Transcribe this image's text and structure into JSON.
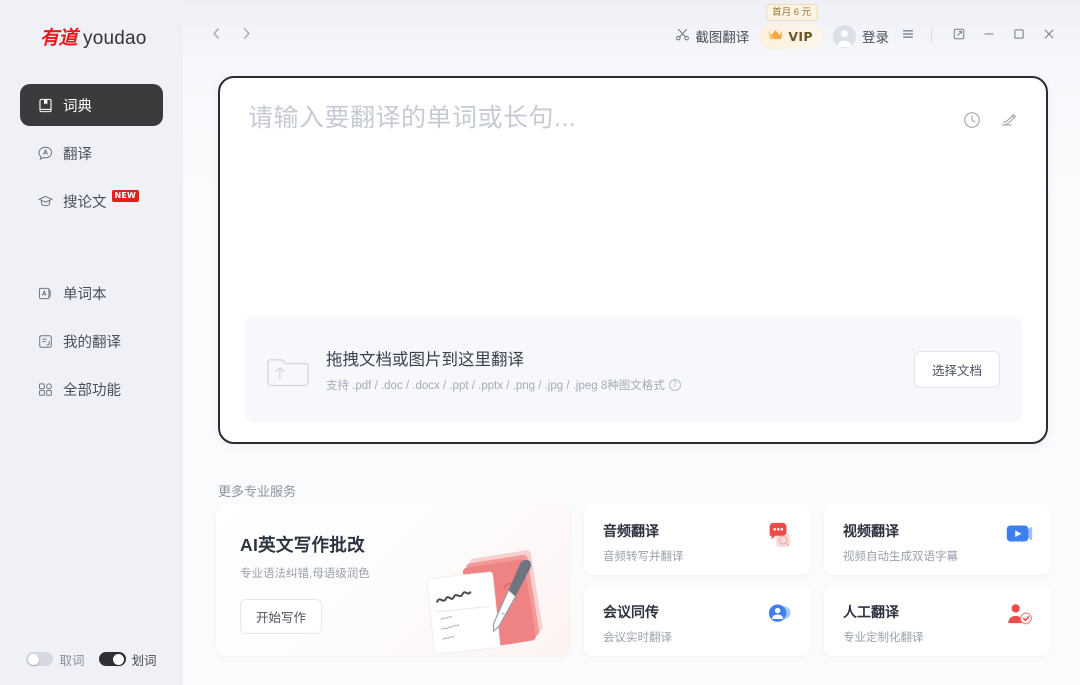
{
  "app": {
    "brand_cn": "有道",
    "brand_en": "youdao",
    "accent_red": "#e8191b",
    "active_pill": "#3b3b3d",
    "sidebar_bg": "#eff1f7"
  },
  "sidebar": {
    "items": [
      {
        "label": "词典",
        "icon": "book-icon",
        "active": true,
        "badge": ""
      },
      {
        "label": "翻译",
        "icon": "translate-icon",
        "active": false,
        "badge": ""
      },
      {
        "label": "搜论文",
        "icon": "graduation-icon",
        "active": false,
        "badge": "NEW"
      }
    ],
    "items2": [
      {
        "label": "单词本",
        "icon": "wordbook-icon",
        "active": false,
        "badge": ""
      },
      {
        "label": "我的翻译",
        "icon": "mytrans-icon",
        "active": false,
        "badge": ""
      },
      {
        "label": "全部功能",
        "icon": "grid-icon",
        "active": false,
        "badge": ""
      }
    ],
    "toggles": [
      {
        "label": "取词",
        "state": "off",
        "icon": "toggle-off-icon"
      },
      {
        "label": "划词",
        "state": "on",
        "icon": "toggle-on-icon"
      }
    ]
  },
  "titlebar": {
    "back_icon": "chevron-left-icon",
    "forward_icon": "chevron-right-icon",
    "screenshot_translate": {
      "label": "截图翻译",
      "icon": "scissors-icon"
    },
    "vip": {
      "label": "VIP",
      "tip": "首月 6 元",
      "icon": "crown-icon"
    },
    "login": {
      "label": "登录",
      "icon": "avatar-icon"
    },
    "menu_icon": "hamburger-icon",
    "window": {
      "mini_icon": "mini-window-icon",
      "minimize_icon": "minimize-icon",
      "maximize_icon": "maximize-icon",
      "close_icon": "close-icon"
    }
  },
  "search": {
    "placeholder": "请输入要翻译的单词或长句...",
    "value": "",
    "history_icon": "clock-icon",
    "handwrite_icon": "handwriting-icon"
  },
  "dropzone": {
    "icon": "upload-folder-icon",
    "title": "拖拽文档或图片到这里翻译",
    "subtitle": "支持 .pdf / .doc / .docx / .ppt / .pptx / .png / .jpg / .jpeg 8种图文格式",
    "help_icon": "question-icon",
    "button": "选择文档"
  },
  "services": {
    "heading": "更多专业服务",
    "featured": {
      "title": "AI英文写作批改",
      "subtitle": "专业语法纠错,母语级润色",
      "button": "开始写作",
      "illustration": "writing-papers-pen-illustration"
    },
    "cards": [
      {
        "name": "音频翻译",
        "desc": "音频转写并翻译",
        "icon": "audio-bubble-icon"
      },
      {
        "name": "视频翻译",
        "desc": "视频自动生成双语字幕",
        "icon": "video-play-icon"
      },
      {
        "name": "会议同传",
        "desc": "会议实时翻译",
        "icon": "meeting-person-icon"
      },
      {
        "name": "人工翻译",
        "desc": "专业定制化翻译",
        "icon": "human-check-icon"
      }
    ]
  }
}
